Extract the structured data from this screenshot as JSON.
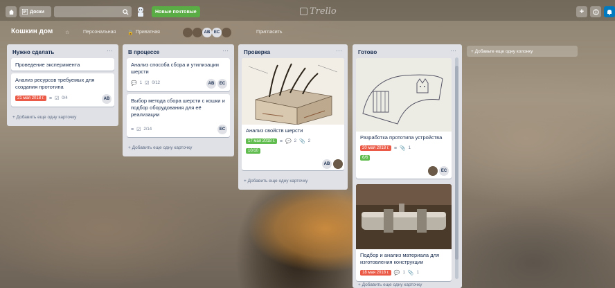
{
  "topbar": {
    "boards_label": "Доски",
    "new_process_label": "Новые почтовые",
    "logo_text": "Trello"
  },
  "board": {
    "title": "Кошкин дом",
    "personal_label": "Персональная",
    "private_label": "Приватная",
    "invite_label": "Пригласить",
    "members": [
      "AB",
      "EC"
    ]
  },
  "lists": [
    {
      "title": "Нужно сделать",
      "cards": [
        {
          "title": "Проведение эксперимента"
        },
        {
          "title": "Анализ ресурсов требуемых для создания прототипа",
          "date": "21 мая 2018 г.",
          "checklist": "0/4",
          "member": "AB"
        }
      ],
      "add_card": "+ Добавить еще одну карточку"
    },
    {
      "title": "В процессе",
      "cards": [
        {
          "title": "Анализ способа сбора и утилизации шерсти",
          "comments": "1",
          "checklist": "0/12",
          "members": [
            "AB",
            "EC"
          ]
        },
        {
          "title": "Выбор метода сбора шерсти с кошки и подбор оборудования для её реализации",
          "checklist": "2/14",
          "member": "EC"
        }
      ],
      "add_card": "+ Добавить еще одну карточку"
    },
    {
      "title": "Проверка",
      "cards": [
        {
          "title": "Анализ свойств шерсти",
          "date": "17 мая 2018 г.",
          "comments": "2",
          "attachments": "2",
          "checklist": "10/10",
          "member": "AB"
        }
      ],
      "add_card": "+ Добавить еще одну карточку"
    },
    {
      "title": "Готово",
      "cards": [
        {
          "title": "Разработка прототипа устройства",
          "date": "20 мая 2018 г.",
          "attachments": "1",
          "checklist": "6/6",
          "member": "EC"
        },
        {
          "title": "Подбор и анализ материала для изготовления конструкции",
          "date": "18 мая 2018 г.",
          "comments": "1",
          "attachments": "1"
        }
      ],
      "add_card": "+ Добавить еще одну карточку"
    }
  ],
  "add_list_label": "+ Добавьте еще одну колонку",
  "colors": {
    "list_bg": "#dfe1e6",
    "date_red": "#eb5a46",
    "green": "#61bd4f",
    "header_green": "#5aac44",
    "header_blue": "#0079bf"
  }
}
